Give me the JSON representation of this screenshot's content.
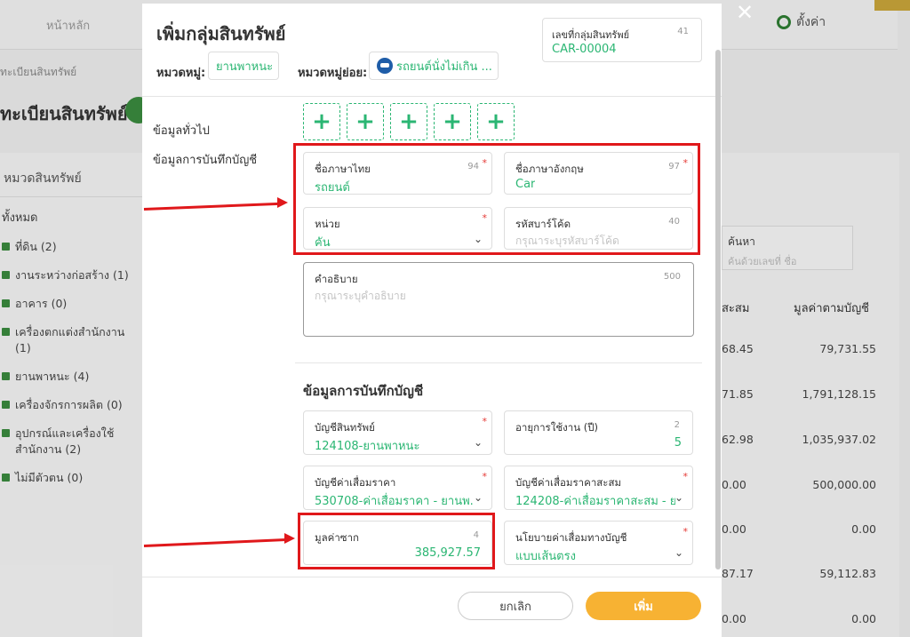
{
  "background": {
    "home_label": "หน้าหลัก",
    "settings_label": "ตั้งค่า",
    "breadcrumb": "ทะเบียนสินทรัพย์",
    "page_title": "ทะเบียนสินทรัพย์",
    "category_panel_title": "หมวดสินทรัพย์",
    "category_all": "ทั้งหมด",
    "categories": [
      "ที่ดิน (2)",
      "งานระหว่างก่อสร้าง (1)",
      "อาคาร (0)",
      "เครื่องตกแต่งสำนักงาน (1)",
      "ยานพาหนะ (4)",
      "เครื่องจักรการผลิต (0)",
      "อุปกรณ์และเครื่องใช้สำนักงาน (2)",
      "ไม่มีตัวตน (0)"
    ],
    "search_label": "ค้นหา",
    "search_placeholder": "ค้นด้วยเลขที่ ชื่อ",
    "col_accum": "สะสม",
    "col_book": "มูลค่าตามบัญชี",
    "rows": [
      {
        "accum": "68.45",
        "book": "79,731.55"
      },
      {
        "accum": "71.85",
        "book": "1,791,128.15"
      },
      {
        "accum": "62.98",
        "book": "1,035,937.02"
      },
      {
        "accum": "0.00",
        "book": "500,000.00"
      },
      {
        "accum": "0.00",
        "book": "0.00"
      },
      {
        "accum": "87.17",
        "book": "59,112.83"
      },
      {
        "accum": "0.00",
        "book": "0.00"
      }
    ]
  },
  "modal": {
    "title": "เพิ่มกลุ่มสินทรัพย์",
    "category_label": "หมวดหมู่:",
    "category_value": "ยานพาหนะ",
    "subcategory_label": "หมวดหมู่ย่อย:",
    "subcategory_value": "รถยนต์นั่งไม่เกิน ...",
    "asset_no_label": "เลขที่กลุ่มสินทรัพย์",
    "asset_no_count": "41",
    "asset_no_value": "CAR-00004",
    "nav": [
      "ข้อมูลทั่วไป",
      "ข้อมูลการบันทึกบัญชี"
    ],
    "plus_label": "+",
    "fields": {
      "thai_name": {
        "label": "ชื่อภาษาไทย",
        "count": "94",
        "value": "รถยนต์"
      },
      "eng_name": {
        "label": "ชื่อภาษาอังกฤษ",
        "count": "97",
        "value": "Car"
      },
      "unit": {
        "label": "หน่วย",
        "value": "คัน"
      },
      "barcode": {
        "label": "รหัสบาร์โค้ด",
        "count": "40",
        "placeholder": "กรุณาระบุรหัสบาร์โค้ด"
      },
      "description": {
        "label": "คำอธิบาย",
        "count": "500",
        "placeholder": "กรุณาระบุคำอธิบาย"
      },
      "asset_account": {
        "label": "บัญชีสินทรัพย์",
        "value": "124108-ยานพาหนะ"
      },
      "useful_life": {
        "label": "อายุการใช้งาน (ปี)",
        "count": "2",
        "value": "5"
      },
      "depr_account": {
        "label": "บัญชีค่าเสื่อมราคา",
        "value": "530708-ค่าเสื่อมราคา - ยานพ..."
      },
      "accum_depr_account": {
        "label": "บัญชีค่าเสื่อมราคาสะสม",
        "value": "124208-ค่าเสื่อมราคาสะสม - ย..."
      },
      "salvage": {
        "label": "มูลค่าซาก",
        "count": "4",
        "value": "385,927.57"
      },
      "depr_policy": {
        "label": "นโยบายค่าเสื่อมทางบัญชี",
        "value": "แบบเส้นตรง"
      }
    },
    "required_mark": "*",
    "accounting_section_title": "ข้อมูลการบันทึกบัญชี",
    "cancel_label": "ยกเลิก",
    "add_label": "เพิ่ม",
    "close_label": "✕"
  },
  "colors": {
    "accent_green": "#2bb673",
    "primary_yellow": "#f7b233",
    "annotation_red": "#e0181b"
  }
}
